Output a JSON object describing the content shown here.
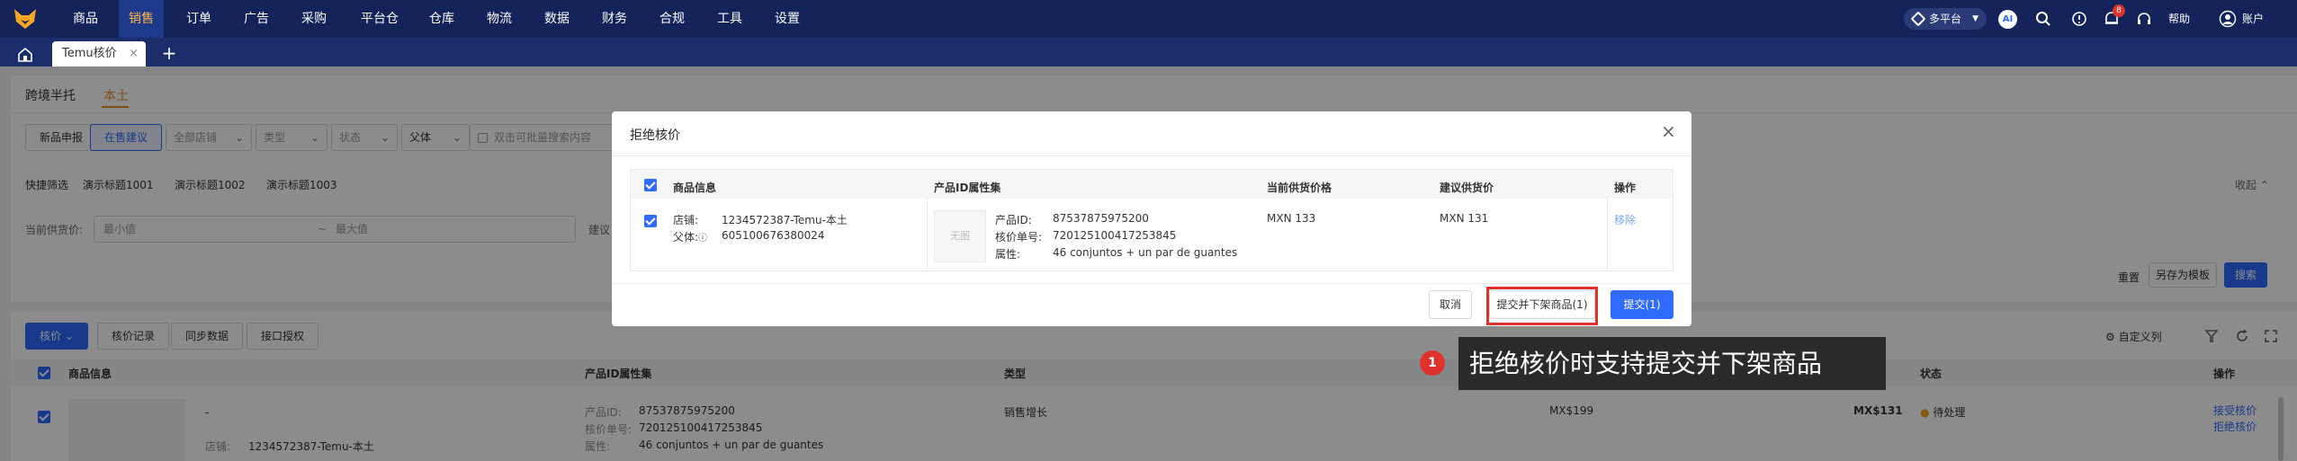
{
  "nav": {
    "items": [
      "商品",
      "销售",
      "订单",
      "广告",
      "采购",
      "平台仓",
      "仓库",
      "物流",
      "数据",
      "财务",
      "合规",
      "工具",
      "设置"
    ],
    "platform": "多平台",
    "ai": "AI",
    "bell_count": "8",
    "help": "帮助",
    "account": "账户"
  },
  "tabs": {
    "current": "Temu核价",
    "close": "×",
    "add": "+"
  },
  "subtabs": [
    "跨境半托",
    "本土"
  ],
  "filters": {
    "btn_new": "新品申报",
    "btn_on_sale": "在售建议",
    "store": "全部店铺",
    "type": "类型",
    "status": "状态",
    "parent": "父体",
    "search_placeholder": "双击可批量搜索内容",
    "quick_label": "快捷筛选",
    "quick": [
      "演示标题1001",
      "演示标题1002",
      "演示标题1003"
    ],
    "collapse": "收起",
    "price_label": "当前供货价:",
    "min_placeholder": "最小值",
    "max_placeholder": "最大值",
    "suggest_label": "建议",
    "reset": "重置",
    "save_template": "另存为模板",
    "search": "搜索"
  },
  "toolbar": {
    "price_check": "核价",
    "history": "核价记录",
    "sync": "同步数据",
    "auth": "接口授权",
    "custom_cols": "自定义列"
  },
  "table": {
    "headers": [
      "商品信息",
      "产品ID属性集",
      "类型",
      "状态",
      "操作"
    ],
    "row": {
      "dash": "-",
      "store_label": "店铺:",
      "store": "1234572387-Temu-本土",
      "product_id_label": "产品ID:",
      "product_id": "87537875975200",
      "check_no_label": "核价单号:",
      "check_no": "720125100417253845",
      "attr_label": "属性:",
      "attr": "46 conjuntos + un par de guantes",
      "type": "销售增长",
      "price1": "MX$199",
      "price2": "MX$131",
      "status": "待处理",
      "action_accept": "接受核价",
      "action_reject": "拒绝核价"
    }
  },
  "modal": {
    "title": "拒绝核价",
    "close": "×",
    "headers": [
      "商品信息",
      "产品ID属性集",
      "当前供货价格",
      "建议供货价",
      "操作"
    ],
    "row": {
      "store_label": "店铺:",
      "store": "1234572387-Temu-本土",
      "parent_label": "父体:",
      "parent": "605100676380024",
      "no_image": "无图",
      "product_id_label": "产品ID:",
      "product_id": "87537875975200",
      "check_no_label": "核价单号:",
      "check_no": "720125100417253845",
      "attr_label": "属性:",
      "attr": "46 conjuntos + un par de guantes",
      "current_price": "MXN 133",
      "suggest_price": "MXN 131",
      "remove": "移除"
    },
    "cancel": "取消",
    "submit_delist": "提交并下架商品(1)",
    "submit": "提交(1)"
  },
  "annotation": {
    "number": "1",
    "text": "拒绝核价时支持提交并下架商品"
  },
  "colors": {
    "nav_bg": "#14235a",
    "accent": "#ffb649",
    "primary": "#2f6bff",
    "highlight": "#e0322d"
  }
}
